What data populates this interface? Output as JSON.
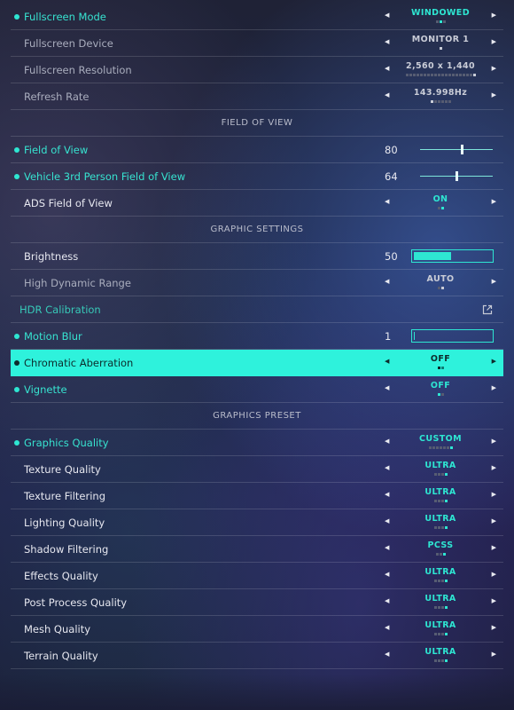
{
  "display": [
    {
      "label": "Fullscreen Mode",
      "value": "WINDOWED",
      "pips": 3,
      "active": 1,
      "style": "mod"
    },
    {
      "label": "Fullscreen Device",
      "value": "MONITOR 1",
      "pips": 1,
      "active": 0,
      "style": "dim"
    },
    {
      "label": "Fullscreen Resolution",
      "value": "2,560 x 1,440",
      "pips": 20,
      "active": 19,
      "style": "dim"
    },
    {
      "label": "Refresh Rate",
      "value": "143.998Hz",
      "pips": 6,
      "active": 0,
      "style": "dim"
    }
  ],
  "fov_header": "FIELD OF VIEW",
  "fov": {
    "fov": {
      "label": "Field of View",
      "value": "80",
      "fraction": 0.57
    },
    "vehicle": {
      "label": "Vehicle 3rd Person Field of View",
      "value": "64",
      "fraction": 0.5
    },
    "ads": {
      "label": "ADS Field of View",
      "value": "ON",
      "pips": 2,
      "active": 1
    }
  },
  "graphic_header": "GRAPHIC SETTINGS",
  "graphic": {
    "brightness": {
      "label": "Brightness",
      "value": "50",
      "fraction": 0.5
    },
    "hdr": {
      "label": "High Dynamic Range",
      "value": "AUTO",
      "pips": 2,
      "active": 1
    },
    "hdr_cal": {
      "label": "HDR Calibration",
      "icon": "external-link-icon"
    },
    "motion_blur": {
      "label": "Motion Blur",
      "value": "1",
      "fraction": 0.01
    },
    "chromatic": {
      "label": "Chromatic Aberration",
      "value": "OFF",
      "pips": 2,
      "active": 0
    },
    "vignette": {
      "label": "Vignette",
      "value": "OFF",
      "pips": 2,
      "active": 0
    }
  },
  "preset_header": "GRAPHICS PRESET",
  "preset": [
    {
      "label": "Graphics Quality",
      "value": "CUSTOM",
      "pips": 7,
      "active": 6,
      "style": "mod"
    },
    {
      "label": "Texture Quality",
      "value": "ULTRA",
      "pips": 4,
      "active": 3,
      "style": "plain"
    },
    {
      "label": "Texture Filtering",
      "value": "ULTRA",
      "pips": 4,
      "active": 3,
      "style": "plain"
    },
    {
      "label": "Lighting Quality",
      "value": "ULTRA",
      "pips": 4,
      "active": 3,
      "style": "plain"
    },
    {
      "label": "Shadow Filtering",
      "value": "PCSS",
      "pips": 3,
      "active": 2,
      "style": "plain"
    },
    {
      "label": "Effects Quality",
      "value": "ULTRA",
      "pips": 4,
      "active": 3,
      "style": "plain"
    },
    {
      "label": "Post Process Quality",
      "value": "ULTRA",
      "pips": 4,
      "active": 3,
      "style": "plain"
    },
    {
      "label": "Mesh Quality",
      "value": "ULTRA",
      "pips": 4,
      "active": 3,
      "style": "plain"
    },
    {
      "label": "Terrain Quality",
      "value": "ULTRA",
      "pips": 4,
      "active": 3,
      "style": "plain"
    }
  ],
  "arrows": {
    "left": "◀",
    "right": "▶"
  },
  "colors": {
    "accent": "#2ee6d2",
    "highlight": "#2ef2dc"
  }
}
